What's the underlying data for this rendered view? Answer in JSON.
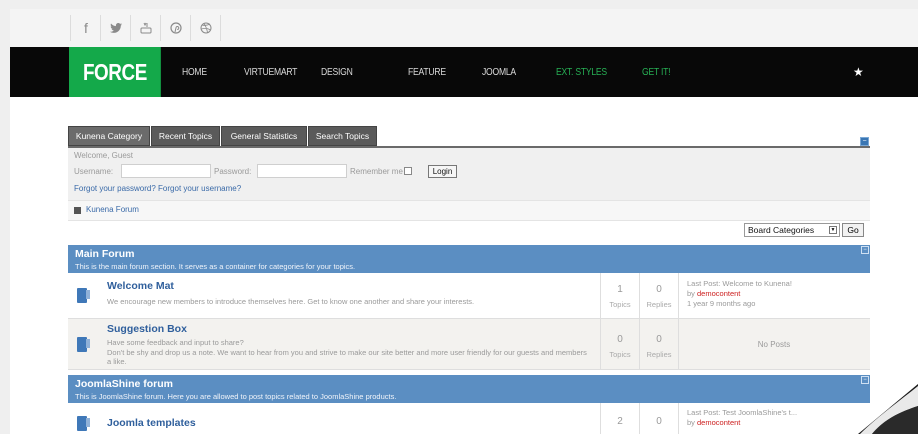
{
  "social": {
    "icons": [
      "facebook-icon",
      "twitter-icon",
      "youtube-icon",
      "pinterest-icon",
      "dribbble-icon"
    ],
    "glyphs": [
      "f",
      "𝕥",
      "▣",
      "⊛",
      "⊕"
    ]
  },
  "nav": {
    "logo": "FORCE",
    "items": [
      "HOME",
      "VIRTUEMART",
      "DESIGN",
      "FEATURE",
      "JOOMLA",
      "EXT. STYLES",
      "GET IT!"
    ],
    "star": "★"
  },
  "tabs": [
    "Kunena Category",
    "Recent Topics",
    "General Statistics",
    "Search Topics"
  ],
  "login": {
    "welcome": "Welcome, Guest",
    "username_label": "Username:",
    "password_label": "Password:",
    "remember_label": "Remember me",
    "login_button": "Login",
    "forgot": "Forgot your password? Forgot your username?"
  },
  "breadcrumb": "Kunena Forum",
  "board_select": {
    "value": "Board Categories",
    "go": "Go"
  },
  "sections": [
    {
      "title": "Main Forum",
      "desc": "This is the main forum section. It serves as a container for categories for your topics.",
      "rows": [
        {
          "title": "Welcome Mat",
          "desc": "We encourage new members to introduce themselves here. Get to know one another and share your interests.",
          "topics": "1",
          "replies": "0",
          "topics_label": "Topics",
          "replies_label": "Replies",
          "last_post": "Last Post: Welcome to Kunena!",
          "by_prefix": "by ",
          "by": "democontent",
          "ago": "1 year 9 months ago"
        },
        {
          "title": "Suggestion Box",
          "desc1": "Have some feedback and input to share?",
          "desc2": "Don't be shy and drop us a note. We want to hear from you and strive to make our site better and more user friendly for our guests and members a like.",
          "topics": "0",
          "replies": "0",
          "topics_label": "Topics",
          "replies_label": "Replies",
          "last_post": "No Posts"
        }
      ]
    },
    {
      "title": "JoomlaShine forum",
      "desc": "This is JoomlaShine forum. Here you are allowed to post topics related to JoomlaShine products.",
      "rows": [
        {
          "title": "Joomla templates",
          "topics": "2",
          "replies": "0",
          "last_post": "Last Post: Test JoomlaShine's t...",
          "by_prefix": "by ",
          "by": "democontent"
        }
      ]
    }
  ],
  "colors": {
    "accent_green": "#14a94a",
    "section_blue": "#5b8ec2",
    "nav_black": "#080808"
  }
}
